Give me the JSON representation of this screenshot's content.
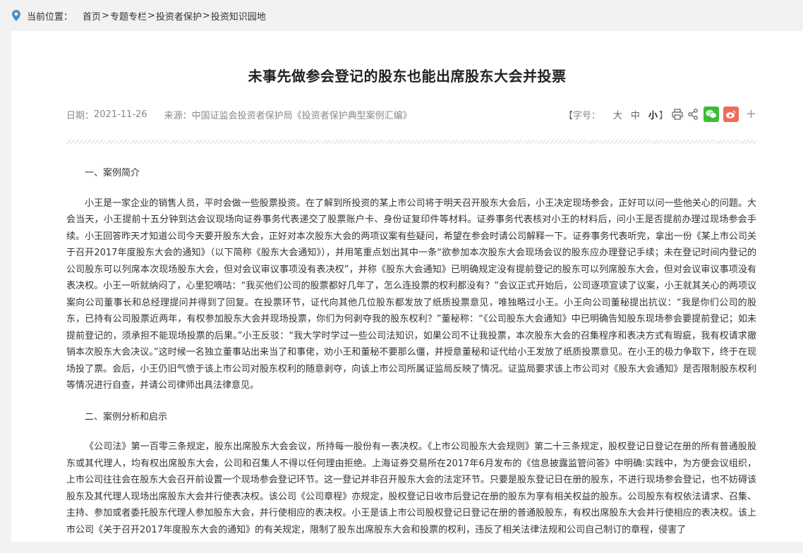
{
  "breadcrumb": {
    "location_label": "当前位置：",
    "items": [
      "首页",
      "专题专栏",
      "投资者保护",
      "投资知识园地"
    ],
    "separator": ">"
  },
  "article": {
    "title": "未事先做参会登记的股东也能出席股东大会并投票",
    "date_label": "日期：",
    "date": "2021-11-26",
    "source_label": "来源：",
    "source": "中国证监会投资者保护局《投资者保护典型案例汇编》"
  },
  "tools": {
    "bracket_open": "【",
    "font_size_label": "字号：",
    "large": "大",
    "medium": "中",
    "small": "小",
    "bracket_close": "】",
    "more": "+"
  },
  "body": {
    "heading1": "一、案例简介",
    "para1": "小王是一家企业的销售人员，平时会做一些股票投资。在了解到所投资的某上市公司将于明天召开股东大会后，小王决定现场参会，正好可以问一些他关心的问题。大会当天，小王提前十五分钟到达会议现场向证券事务代表递交了股票账户卡、身份证复印件等材料。证券事务代表核对小王的材料后，问小王是否提前办理过现场参会手续。小王回答昨天才知道公司今天要开股东大会，正好对本次股东大会的两项议案有些疑问，希望在参会时请公司解释一下。证券事务代表听完，拿出一份《某上市公司关于召开2017年度股东大会的通知》（以下简称《股东大会通知》），并用笔重点划出其中一条“欲参加本次股东大会现场会议的股东应办理登记手续；未在登记时间内登记的公司股东可以列席本次现场股东大会，但对会议审议事项没有表决权”，并称《股东大会通知》已明确规定没有提前登记的股东可以列席股东大会，但对会议审议事项没有表决权。小王一听就纳闷了，心里犯嘀咕：“我买他们公司的股票都好几年了，怎么连投票的权利都没有？”会议正式开始后，公司逐项宣读了议案，小王就其关心的两项议案向公司董事长和总经理提问并得到了回复。在投票环节，证代向其他几位股东都发放了纸质投票意见，唯独略过小王。小王向公司董秘提出抗议：“我是你们公司的股东，已持有公司股票近两年，有权参加股东大会并现场投票，你们为何剥夺我的股东权利？”董秘称：“《公司股东大会通知》中已明确告知股东现场参会要提前登记；如未提前登记的，须承担不能现场投票的后果。”小王反驳：“我大学时学过一些公司法知识，如果公司不让我投票，本次股东大会的召集程序和表决方式有瑕疵，我有权请求撤销本次股东大会决议。”这时候一名独立董事站出来当了和事佬，劝小王和董秘不要那么僵，并授意董秘和证代给小王发放了纸质投票意见。在小王的极力争取下，终于在现场投了票。会后，小王仍旧气愤于该上市公司对股东权利的随意剥夺，向该上市公司所属证监局反映了情况。证监局要求该上市公司对《股东大会通知》是否限制股东权利等情况进行自查，并请公司律师出具法律意见。",
    "heading2": "二、案例分析和启示",
    "para2": "《公司法》第一百零三条规定，股东出席股东大会会议，所持每一股份有一表决权。《上市公司股东大会规则》第二十三条规定，股权登记日登记在册的所有普通股股东或其代理人，均有权出席股东大会，公司和召集人不得以任何理由拒绝。上海证券交易所在2017年6月发布的《信息披露监管问答》中明确:实践中，为方便会议组织，上市公司往往会在股东大会召开前设置一个现场参会登记环节。这一登记并非召开股东大会的法定环节。只要是股东登记日在册的股东，不进行现场参会登记，也不妨碍该股东及其代理人现场出席股东大会并行使表决权。该公司《公司章程》亦规定，股权登记日收市后登记在册的股东为享有相关权益的股东。公司股东有权依法请求、召集、主持、参加或者委托股东代理人参加股东大会，并行使相应的表决权。小王是该上市公司股权登记日登记在册的普通股股东，有权出席股东大会并行使相应的表决权。该上市公司《关于召开2017年度股东大会的通知》的有关规定，限制了股东出席股东大会和投票的权利，违反了相关法律法规和公司自己制订的章程，侵害了"
  },
  "colors": {
    "wechat": "#3dbc36",
    "weibo": "#f06c5a",
    "location_icon": "#4a90c8"
  }
}
